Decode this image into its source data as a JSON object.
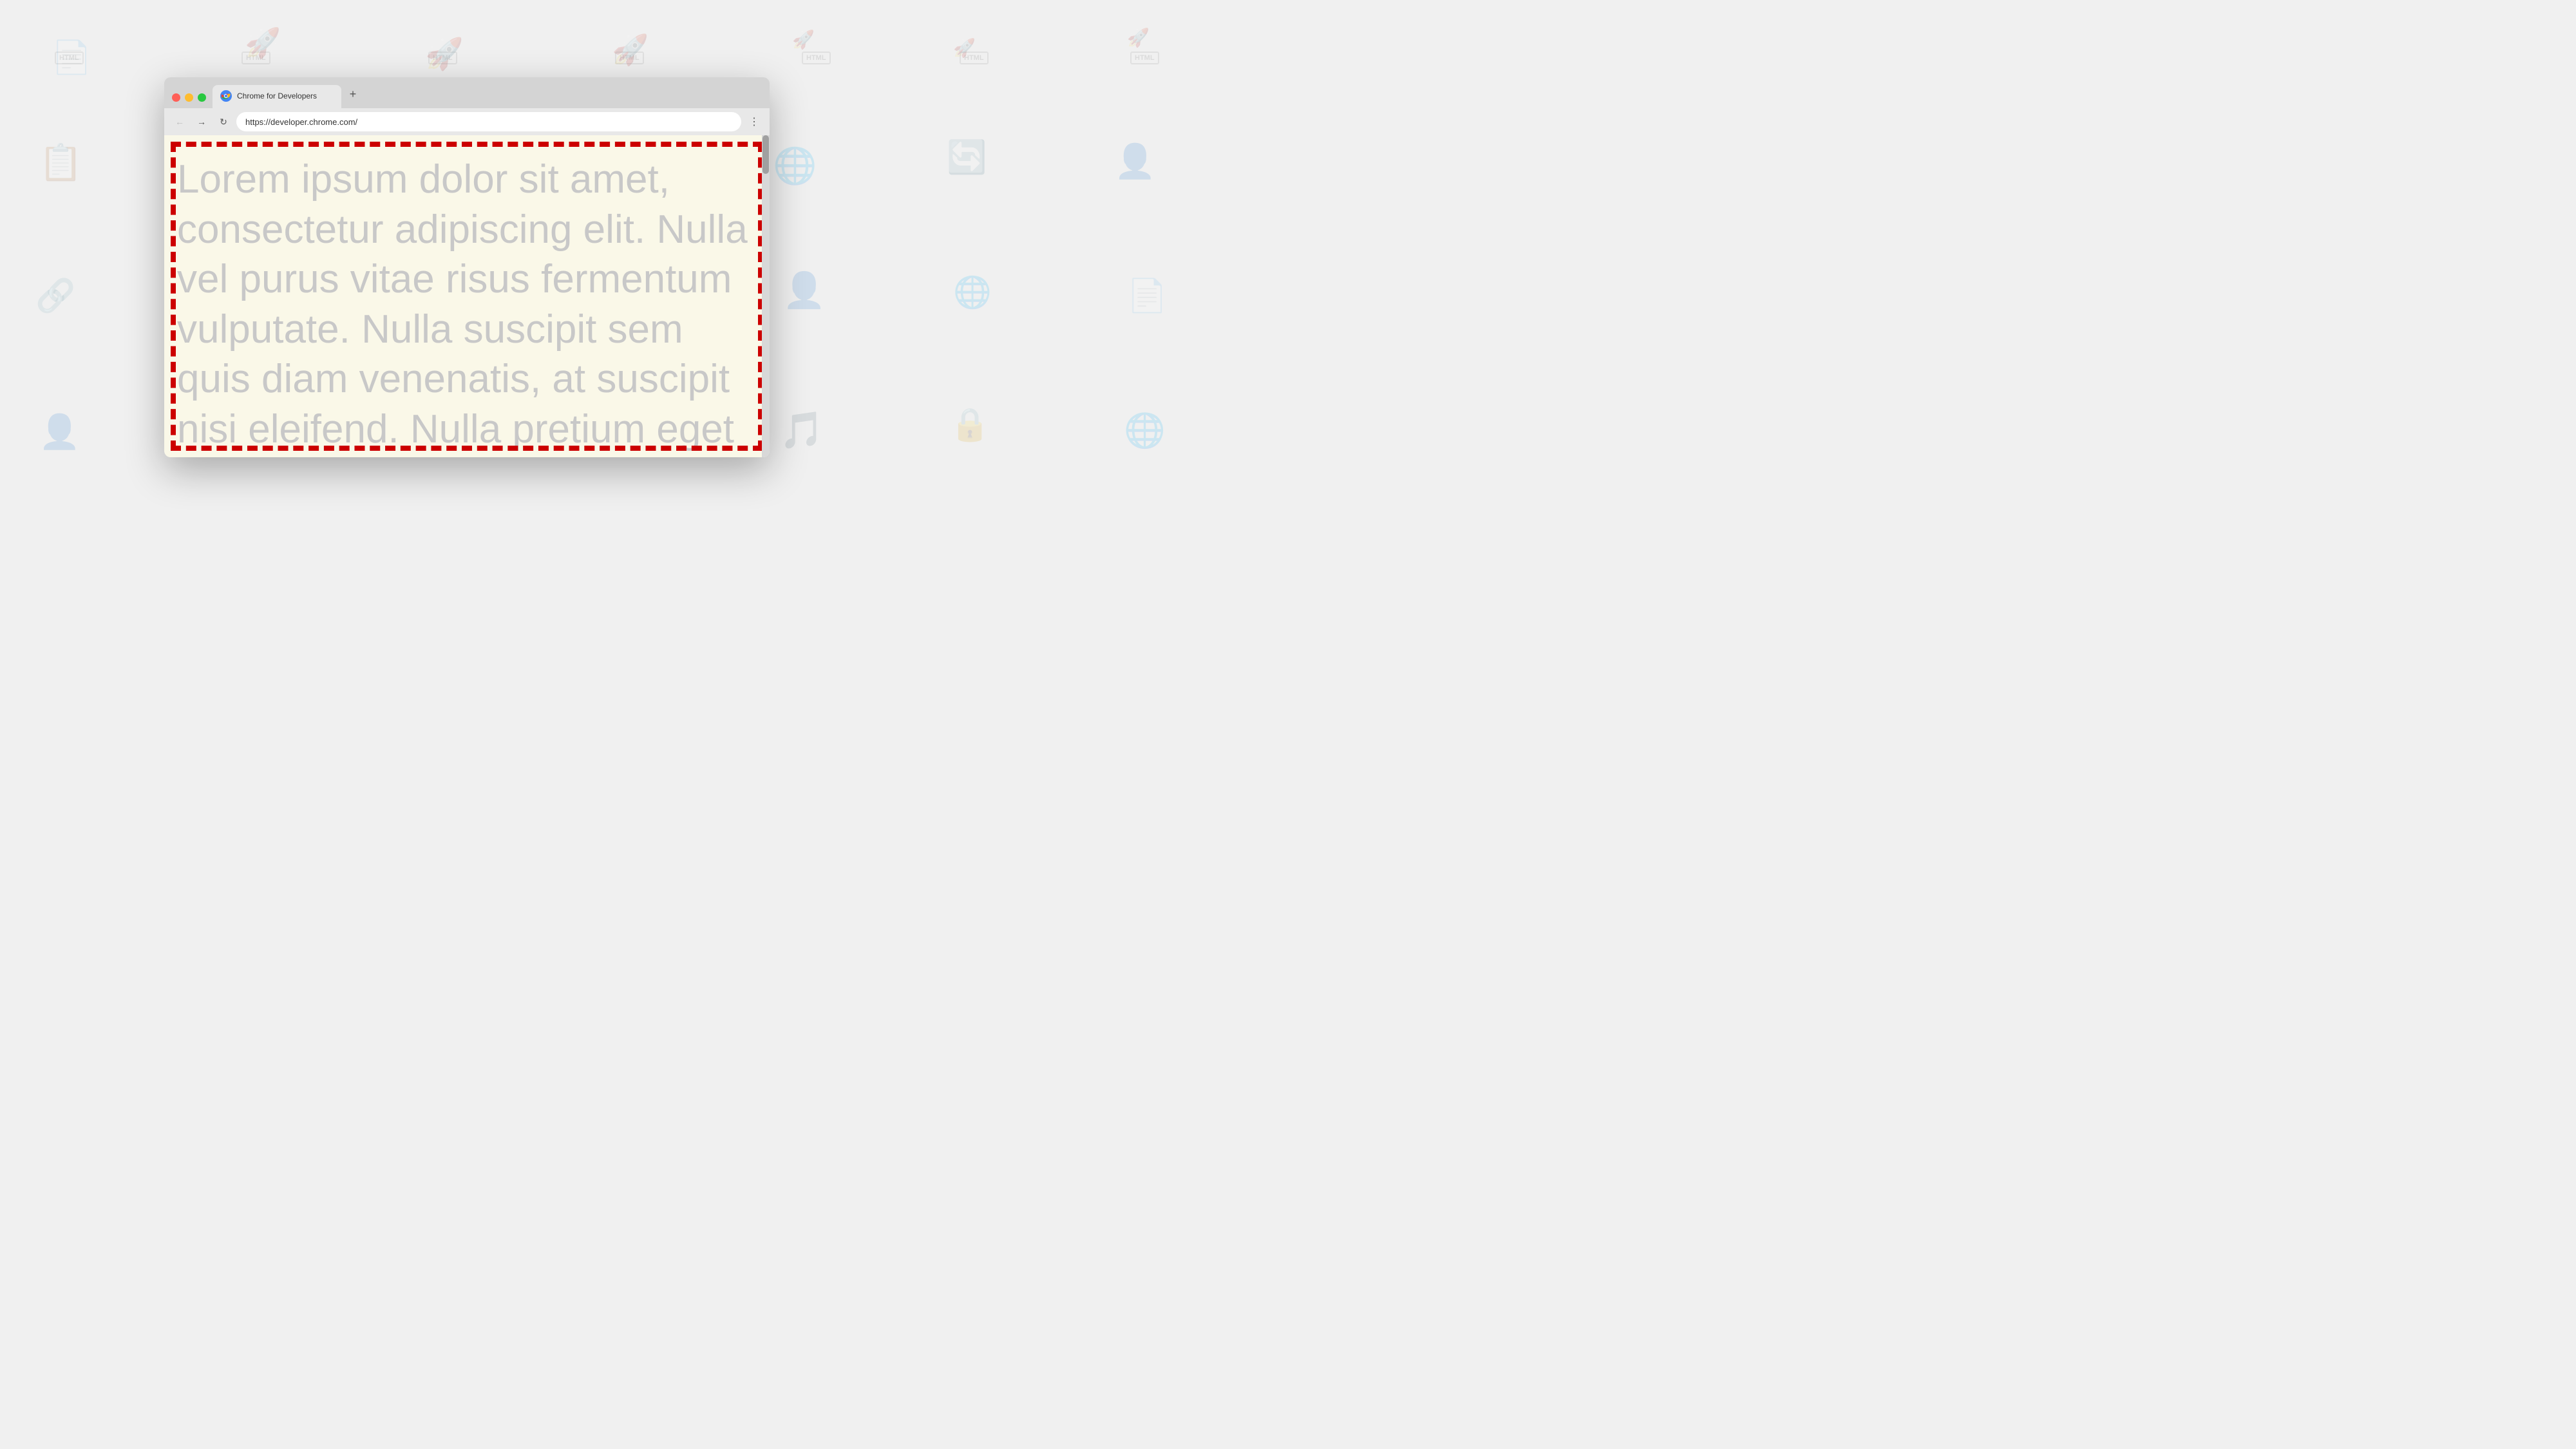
{
  "background": {
    "color": "#f0f0f0"
  },
  "browser": {
    "tab": {
      "title": "Chrome for Developers",
      "favicon": "chrome-icon",
      "new_tab_label": "+"
    },
    "nav": {
      "back_btn": "←",
      "forward_btn": "→",
      "reload_btn": "↻",
      "url": "https://developer.chrome.com/",
      "menu_btn": "⋮"
    },
    "page": {
      "lorem_text": "Lorem ipsum dolor sit amet, consectetur adipiscing elit. Nulla vel purus vitae risus fermentum vulputate. Nulla suscipit sem quis diam venenatis, at suscipit nisi eleifend. Nulla pretium eget",
      "bg_color": "#faf8e8",
      "border_color": "#cc0000"
    }
  }
}
